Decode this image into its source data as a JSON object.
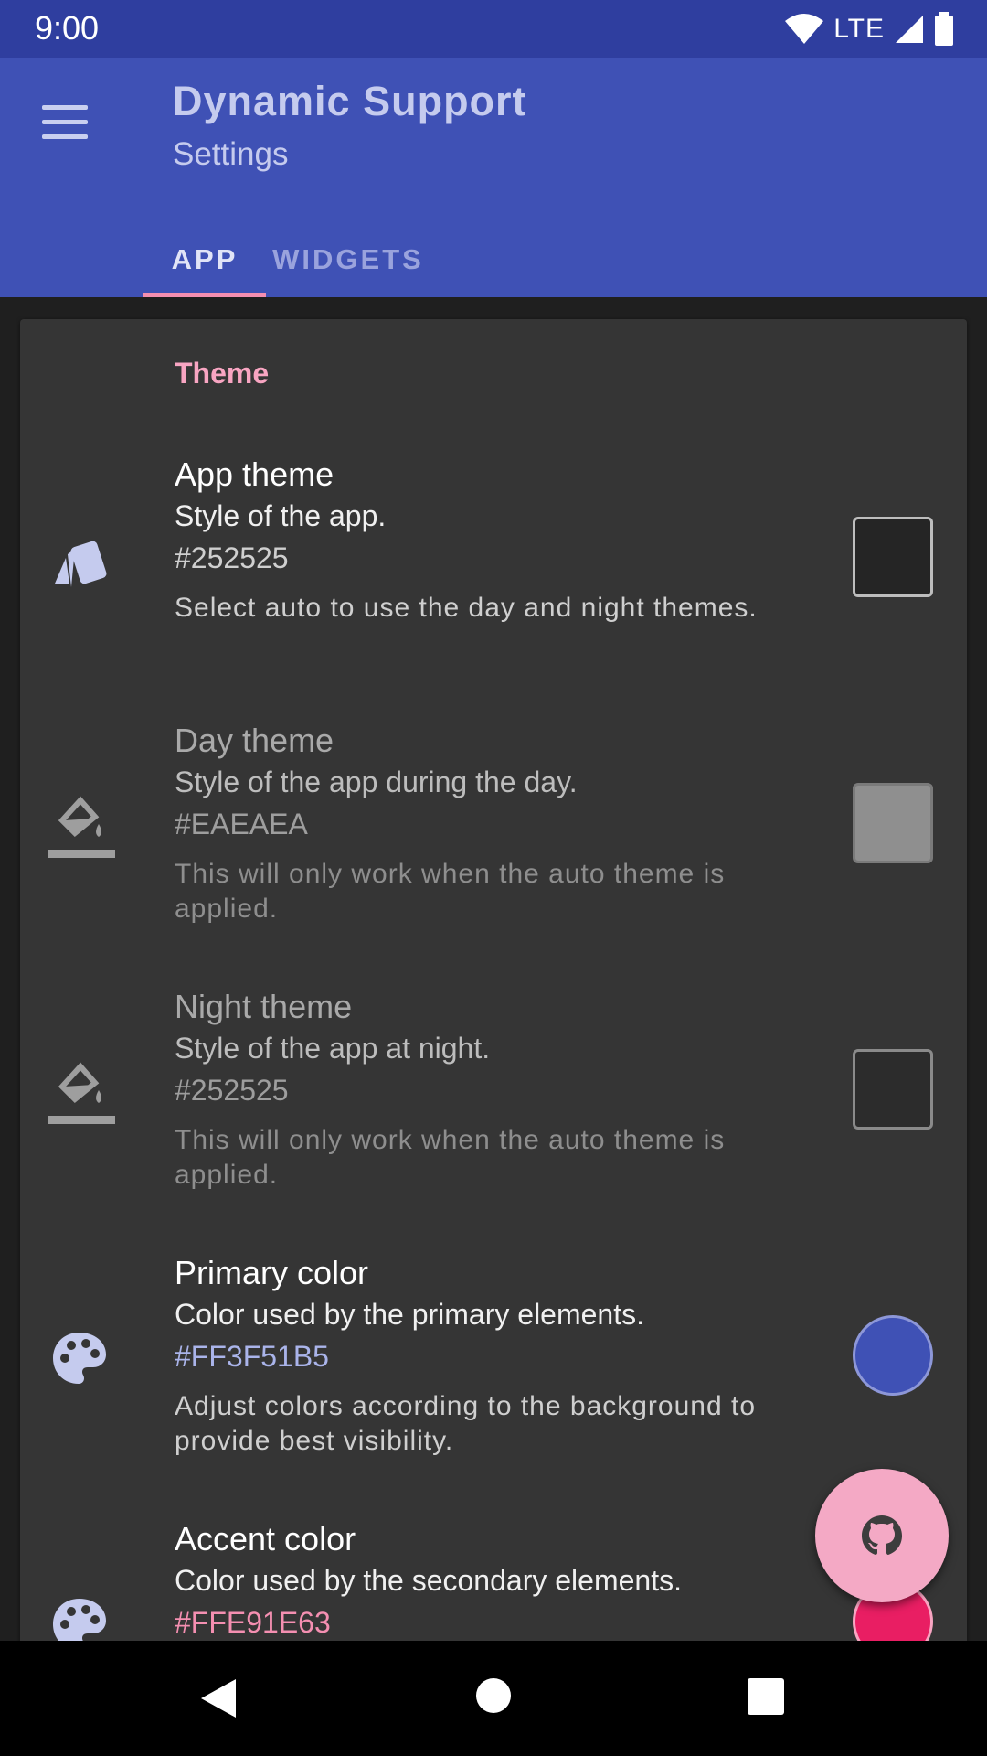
{
  "status_bar": {
    "time": "9:00",
    "network": "LTE"
  },
  "app_bar": {
    "title": "Dynamic Support",
    "subtitle": "Settings"
  },
  "tabs": [
    {
      "label": "APP",
      "selected": true
    },
    {
      "label": "WIDGETS",
      "selected": false
    }
  ],
  "section": {
    "title": "Theme"
  },
  "items": [
    {
      "title": "App theme",
      "summary": "Style of the app.",
      "value": "#252525",
      "description": "Select auto to use the day and night themes.",
      "icon": "cards-icon",
      "swatch_color": "#252525",
      "enabled": true
    },
    {
      "title": "Day theme",
      "summary": "Style of the app during the day.",
      "value": "#EAEAEA",
      "description": "This will only work when the auto theme is applied.",
      "icon": "paint-bucket-icon",
      "swatch_color": "#8f8f8f",
      "enabled": false
    },
    {
      "title": "Night theme",
      "summary": "Style of the app at night.",
      "value": "#252525",
      "description": "This will only work when the auto theme is applied.",
      "icon": "paint-bucket-icon",
      "swatch_color": "#2c2c2c",
      "enabled": false
    },
    {
      "title": "Primary color",
      "summary": "Color used by the primary elements.",
      "value": "#FF3F51B5",
      "description": "Adjust colors according to the background to provide best visibility.",
      "icon": "palette-icon",
      "swatch_color": "#3f51b5",
      "enabled": true
    },
    {
      "title": "Accent color",
      "summary": "Color used by the secondary elements.",
      "value": "#FFE91E63",
      "description": "",
      "icon": "palette-icon",
      "swatch_color": "#e91e63",
      "enabled": true
    }
  ],
  "fab": {
    "icon": "github-icon"
  },
  "colors": {
    "primary": "#3f51b5",
    "primary_dark": "#2f3e9f",
    "accent": "#e91e63",
    "accent_light": "#f4a9c5",
    "background": "#1f1f1f",
    "card": "#353535"
  }
}
